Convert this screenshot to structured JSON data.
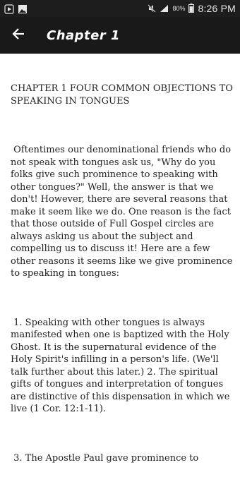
{
  "status_bar": {
    "battery_percent": "80%",
    "time": "8:26 PM",
    "icons": [
      "media-icon",
      "image-icon",
      "mute-icon",
      "signal-icon",
      "battery-icon"
    ]
  },
  "app_bar": {
    "title": "Chapter 1",
    "back_icon": "arrow-left-icon"
  },
  "content": {
    "heading": "CHAPTER 1 FOUR COMMON OBJECTIONS TO SPEAKING IN TONGUES",
    "paragraph_1": " Oftentimes our denominational friends who do not speak with tongues ask us, \"Why do you folks give such prominence to speaking with other tongues?\" Well, the answer is that we don't! However, there are several reasons that make it seem like we do. One reason is the fact that those outside of Full Gospel circles are always asking us about the subject and compelling us to discuss it! Here are a few other reasons it seems like we give prominence to speaking in tongues:",
    "paragraph_2": " 1. Speaking with other tongues is always manifested when one is baptized with the Holy Ghost. It is the supernatural evidence of the Holy Spirit's infilling in a person's life. (We'll talk further about this later.) 2. The spiritual gifts of tongues and interpretation of tongues are distinctive of this dispensation in which we live (1 Cor. 12:1-11).",
    "paragraph_3": " 3. The Apostle Paul gave prominence to"
  }
}
